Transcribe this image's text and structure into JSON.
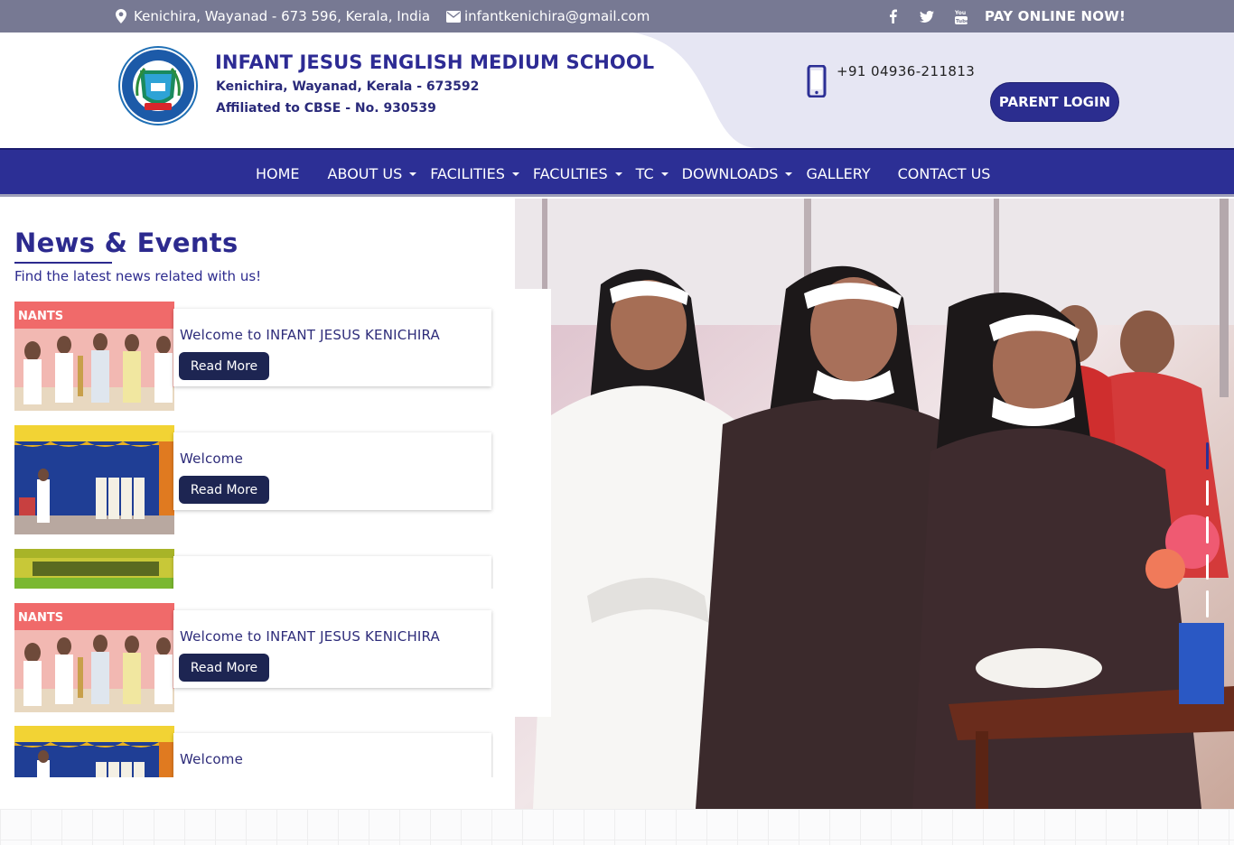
{
  "topbar": {
    "address": "Kenichira, Wayanad - 673 596, Kerala, India",
    "email": "infantkenichira@gmail.com",
    "social": [
      "facebook-icon",
      "twitter-icon",
      "youtube-icon"
    ],
    "pay_online": "PAY ONLINE NOW!"
  },
  "header": {
    "school_name": "INFANT JESUS ENGLISH MEDIUM SCHOOL",
    "address_line": "Kenichira, Wayanad, Kerala - 673592",
    "affiliation": "Affiliated to CBSE - No. 930539",
    "phone": "+91 04936-211813",
    "parent_login": "PARENT LOGIN"
  },
  "nav": {
    "items": [
      {
        "label": "HOME",
        "dropdown": false
      },
      {
        "label": "ABOUT US",
        "dropdown": true
      },
      {
        "label": "FACILITIES",
        "dropdown": true
      },
      {
        "label": "FACULTIES",
        "dropdown": true
      },
      {
        "label": "TC",
        "dropdown": true
      },
      {
        "label": "DOWNLOADS",
        "dropdown": true
      },
      {
        "label": "GALLERY",
        "dropdown": false
      },
      {
        "label": "CONTACT US",
        "dropdown": false
      }
    ]
  },
  "news": {
    "title": "News & Events",
    "subtitle": "Find the latest news related with us!",
    "read_more": "Read More",
    "items": [
      {
        "title": "Welcome to INFANT JESUS KENICHIRA"
      },
      {
        "title": "Welcome"
      },
      {
        "title": ""
      },
      {
        "title": "Welcome to INFANT JESUS KENICHIRA"
      },
      {
        "title": "Welcome"
      }
    ]
  },
  "colors": {
    "topbar": "#777993",
    "brand": "#2c2f95",
    "button_dark": "#1d2552"
  }
}
